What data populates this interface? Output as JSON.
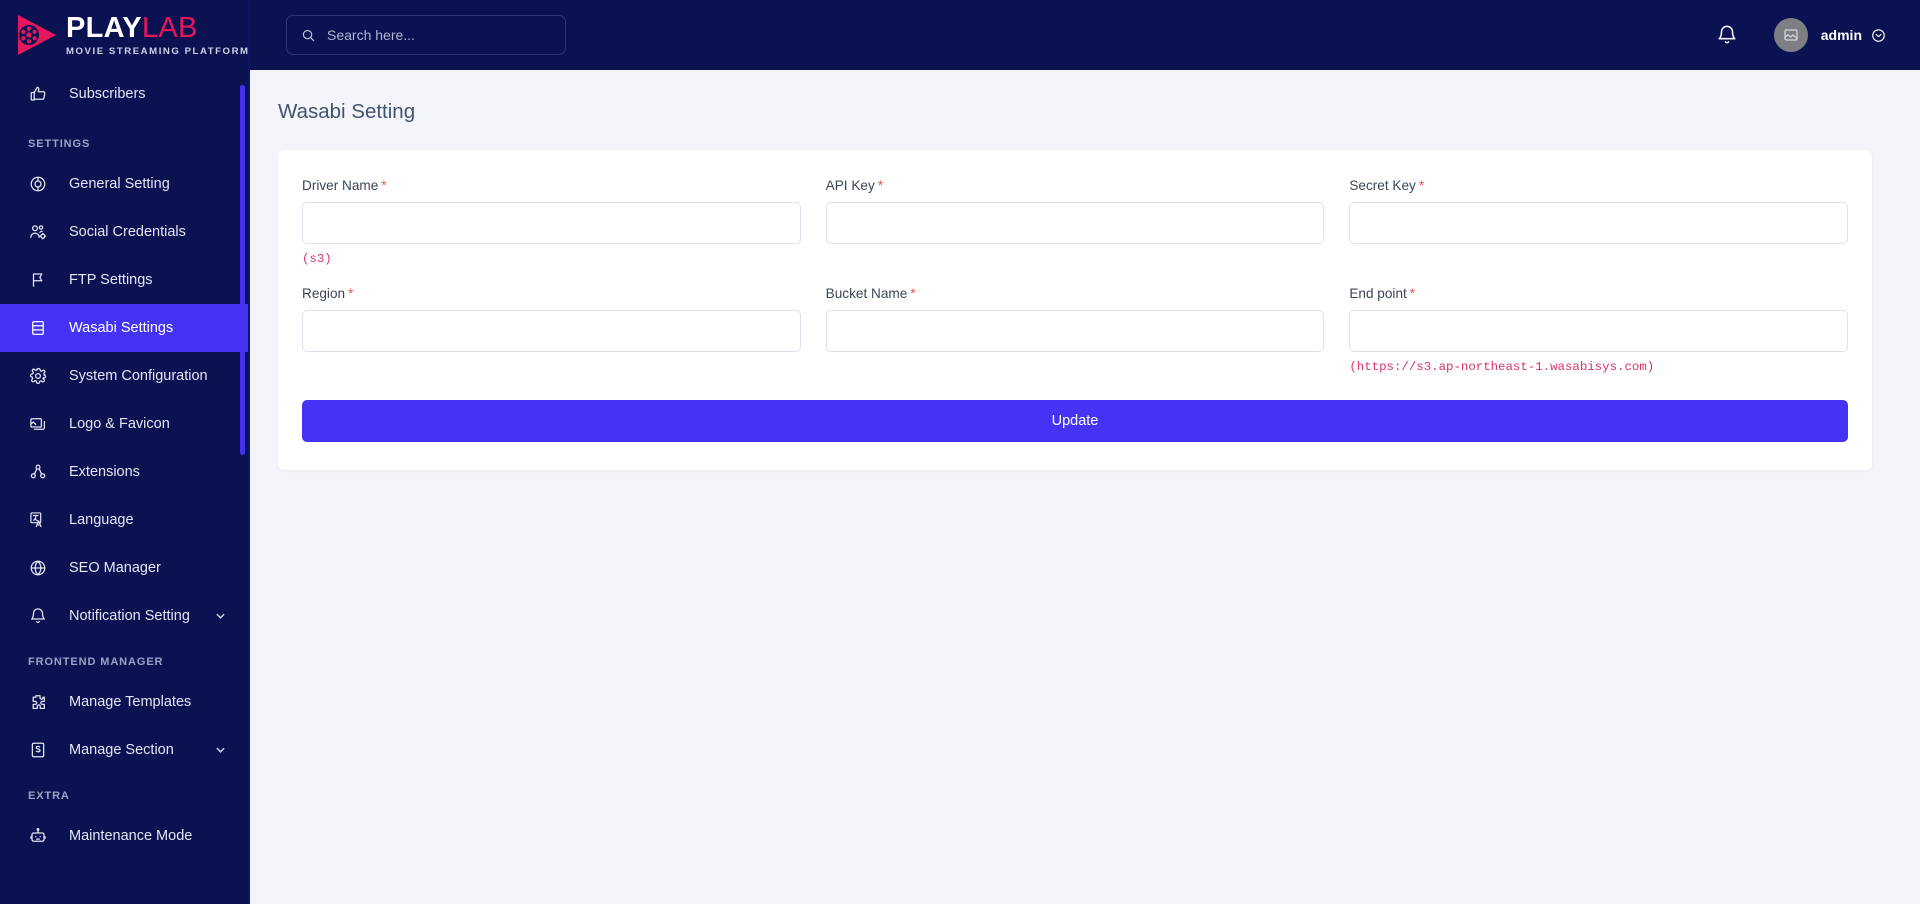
{
  "brand": {
    "name_primary": "PLAY",
    "name_secondary": "LAB",
    "tagline": "MOVIE STREAMING PLATFORM",
    "logo_icon": "film-reel-play-icon",
    "color_primary": "#ffffff",
    "color_secondary": "#e4175c"
  },
  "topbar": {
    "search": {
      "value": "",
      "placeholder": "Search here...",
      "icon": "search-icon"
    },
    "notification_icon": "bell-icon",
    "avatar_icon": "image-placeholder-icon",
    "user_name": "admin",
    "user_caret_icon": "chevron-down-circle-icon"
  },
  "sidebar": {
    "background": "#0a1252",
    "active_color": "#4433f5",
    "items": [
      {
        "label": "Subscribers",
        "icon": "thumbs-up-icon",
        "active": false,
        "expandable": false
      },
      {
        "group": "SETTINGS"
      },
      {
        "label": "General Setting",
        "icon": "settings-circle-icon",
        "active": false,
        "expandable": false
      },
      {
        "label": "Social Credentials",
        "icon": "users-gear-icon",
        "active": false,
        "expandable": false
      },
      {
        "label": "FTP Settings",
        "icon": "flag-icon",
        "active": false,
        "expandable": false
      },
      {
        "label": "Wasabi Settings",
        "icon": "server-icon",
        "active": true,
        "expandable": false
      },
      {
        "label": "System Configuration",
        "icon": "gear-icon",
        "active": false,
        "expandable": false
      },
      {
        "label": "Logo & Favicon",
        "icon": "images-icon",
        "active": false,
        "expandable": false
      },
      {
        "label": "Extensions",
        "icon": "nodes-icon",
        "active": false,
        "expandable": false
      },
      {
        "label": "Language",
        "icon": "language-icon",
        "active": false,
        "expandable": false
      },
      {
        "label": "SEO Manager",
        "icon": "globe-icon",
        "active": false,
        "expandable": false
      },
      {
        "label": "Notification Setting",
        "icon": "bell-icon",
        "active": false,
        "expandable": true
      },
      {
        "group": "FRONTEND MANAGER"
      },
      {
        "label": "Manage Templates",
        "icon": "puzzle-icon",
        "active": false,
        "expandable": false
      },
      {
        "label": "Manage Section",
        "icon": "section-icon",
        "active": false,
        "expandable": true
      },
      {
        "group": "EXTRA"
      },
      {
        "label": "Maintenance Mode",
        "icon": "robot-icon",
        "active": false,
        "expandable": false
      }
    ]
  },
  "main": {
    "page_title": "Wasabi Setting",
    "fields": [
      {
        "label": "Driver Name",
        "required": true,
        "value": "",
        "hint": "(s3)"
      },
      {
        "label": "API Key",
        "required": true,
        "value": "",
        "hint": ""
      },
      {
        "label": "Secret Key",
        "required": true,
        "value": "",
        "hint": ""
      },
      {
        "label": "Region",
        "required": true,
        "value": "",
        "hint": ""
      },
      {
        "label": "Bucket Name",
        "required": true,
        "value": "",
        "hint": ""
      },
      {
        "label": "End point",
        "required": true,
        "value": "",
        "hint": "(https://s3.ap-northeast-1.wasabisys.com)"
      }
    ],
    "submit_label": "Update",
    "submit_color": "#4433f5",
    "required_marker": "*"
  }
}
